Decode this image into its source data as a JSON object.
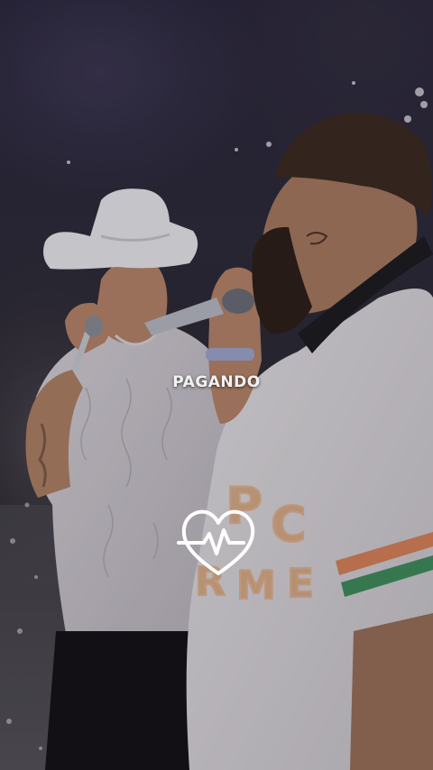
{
  "caption": "PAGANDO",
  "photo": {
    "scene": "photo-of-two-singers-on-stage",
    "heart_icon": "heart-pulse-icon"
  }
}
